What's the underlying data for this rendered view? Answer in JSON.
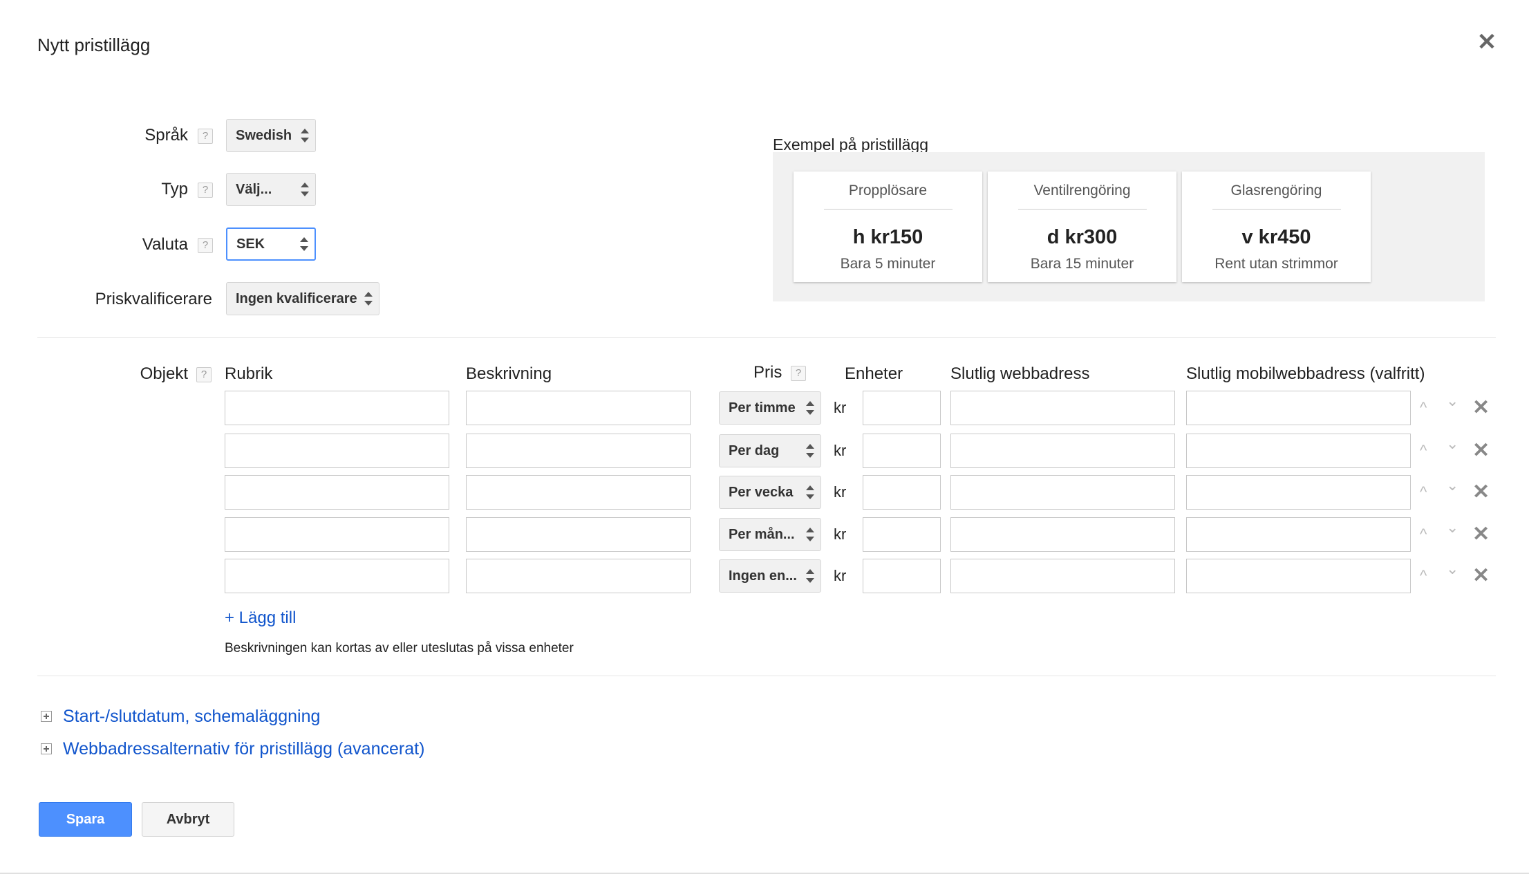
{
  "dialog": {
    "title": "Nytt pristillägg",
    "close_glyph": "✕"
  },
  "form": {
    "language": {
      "label": "Språk",
      "value": "Swedish"
    },
    "type": {
      "label": "Typ",
      "value": "Välj..."
    },
    "currency": {
      "label": "Valuta",
      "value": "SEK"
    },
    "qualifier": {
      "label": "Priskvalificerare",
      "value": "Ingen kvalificerare"
    },
    "help_glyph": "?"
  },
  "example": {
    "label": "Exempel på pristillägg",
    "cards": [
      {
        "header": "Propplösare",
        "price": "h kr150",
        "desc": "Bara 5 minuter"
      },
      {
        "header": "Ventilrengöring",
        "price": "d kr300",
        "desc": "Bara 15 minuter"
      },
      {
        "header": "Glasrengöring",
        "price": "v kr450",
        "desc": "Rent utan strimmor"
      }
    ]
  },
  "items": {
    "label": "Objekt",
    "columns": {
      "heading": "Rubrik",
      "description": "Beskrivning",
      "price": "Pris",
      "units": "Enheter",
      "final_url": "Slutlig webbadress",
      "final_mobile_url": "Slutlig mobilwebbadress (valfritt)"
    },
    "currency_symbol": "kr",
    "rows": [
      {
        "unit": "Per timme"
      },
      {
        "unit": "Per dag"
      },
      {
        "unit": "Per vecka"
      },
      {
        "unit": "Per mån..."
      },
      {
        "unit": "Ingen en..."
      }
    ],
    "move_up_glyph": "^",
    "move_down_glyph": "⌄",
    "delete_glyph": "✕",
    "add_label": "+ Lägg till",
    "note": "Beskrivningen kan kortas av eller uteslutas på vissa enheter"
  },
  "sections": {
    "schedule": "Start-/slutdatum, schemaläggning",
    "url_options": "Webbadressalternativ för pristillägg (avancerat)"
  },
  "actions": {
    "save": "Spara",
    "cancel": "Avbryt"
  },
  "colors": {
    "accent": "#4d90fe",
    "link": "#1155cc"
  }
}
